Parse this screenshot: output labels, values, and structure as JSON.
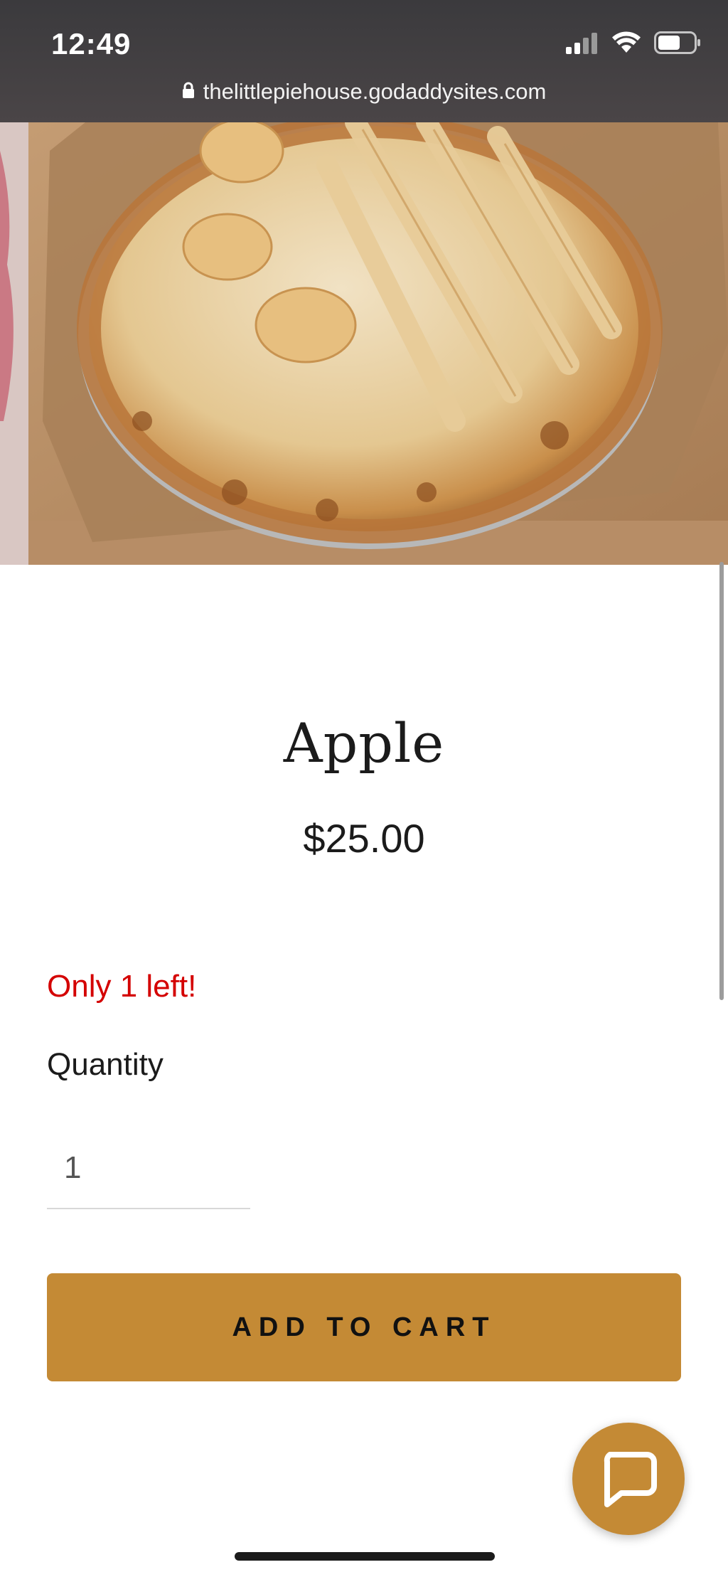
{
  "status_bar": {
    "time": "12:49",
    "icons": [
      "cellular-signal-icon",
      "wifi-icon",
      "battery-icon"
    ]
  },
  "browser": {
    "url": "thelittlepiehouse.godaddysites.com",
    "lock_icon": "lock-icon"
  },
  "hero": {
    "image": "apple-pie-photo"
  },
  "product": {
    "title": "Apple",
    "price": "$25.00",
    "stock_warning": "Only 1 left!",
    "quantity_label": "Quantity",
    "quantity_value": "1",
    "add_to_cart_label": "ADD TO CART"
  },
  "chat": {
    "icon": "chat-bubble-icon"
  },
  "colors": {
    "accent": "#c48a35",
    "warning": "#d40000",
    "text": "#1b1b1b"
  }
}
